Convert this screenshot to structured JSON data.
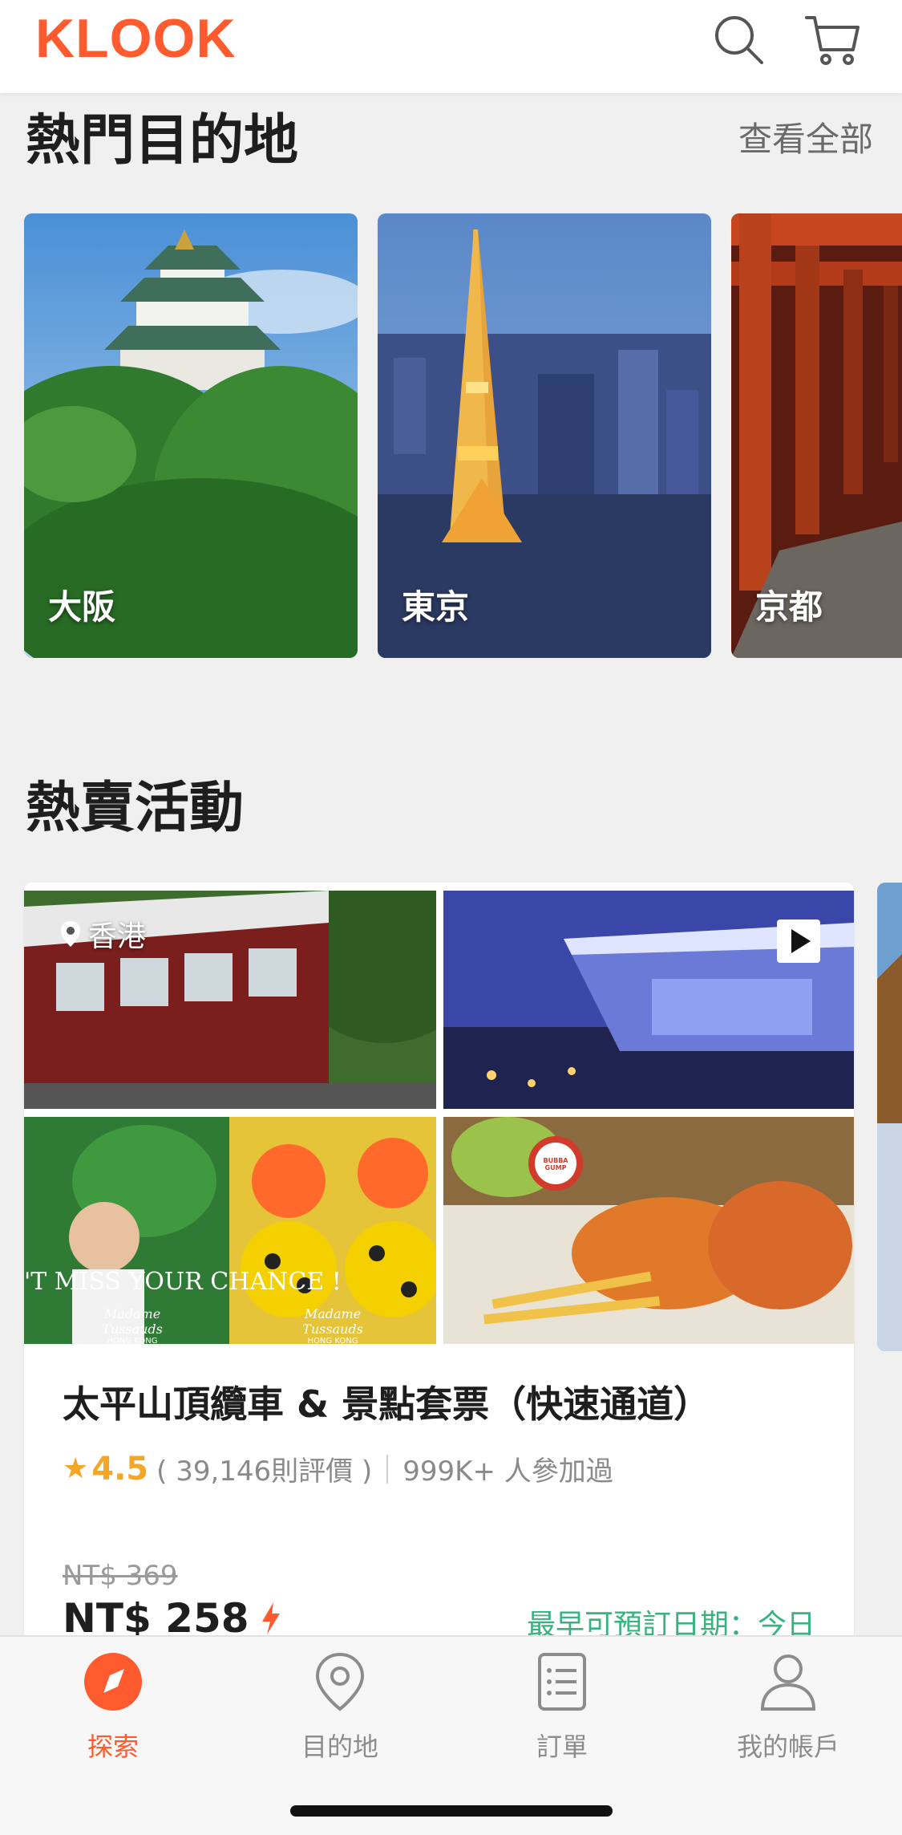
{
  "header": {
    "logo": "KLOOK"
  },
  "destinations": {
    "title": "熱門目的地",
    "view_all": "查看全部",
    "items": [
      {
        "name": "大阪"
      },
      {
        "name": "東京"
      },
      {
        "name": "京都"
      }
    ]
  },
  "hot_activities": {
    "title": "熱賣活動",
    "card": {
      "location": "香港",
      "title": "太平山頂纜車 & 景點套票（快速通道）",
      "rating": "4.5",
      "reviews": "( 39,146則評價 )",
      "participants": "999K+ 人參加過",
      "original_price": "NT$ 369",
      "price": "NT$ 258",
      "earliest_date": "最早可預訂日期：今日",
      "image_text_1": "'T MISS YOUR CHANCE !",
      "image_brand": "Madame Tussauds",
      "image_brand_sub": "HONG KONG",
      "image_logo": "BUBBA GUMP"
    }
  },
  "tabbar": {
    "tabs": [
      {
        "label": "探索",
        "active": true
      },
      {
        "label": "目的地"
      },
      {
        "label": "訂單"
      },
      {
        "label": "我的帳戶"
      }
    ]
  },
  "colors": {
    "brand": "#ff5b2e",
    "rating": "#f5a623",
    "available": "#36b37e"
  }
}
